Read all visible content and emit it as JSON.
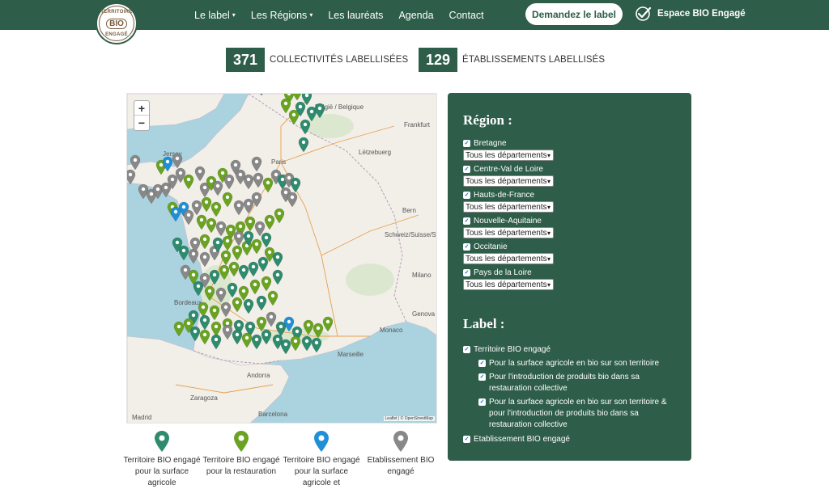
{
  "header": {
    "logo": {
      "top": "TERRITOIRE",
      "middle": "BIO",
      "bottom": "ENGAGÉ"
    },
    "nav": [
      {
        "label": "Le label",
        "has_caret": true
      },
      {
        "label": "Les Régions",
        "has_caret": true
      },
      {
        "label": "Les lauréats",
        "has_caret": false
      },
      {
        "label": "Agenda",
        "has_caret": false
      },
      {
        "label": "Contact",
        "has_caret": false
      }
    ],
    "cta_label": "Demandez le label",
    "espace_label": "Espace BIO Engagé",
    "caret": "▾"
  },
  "stats": [
    {
      "value": "371",
      "label": "COLLECTIVITÉS LABELLISÉES"
    },
    {
      "value": "129",
      "label": "ÉTABLISSEMENTS LABELLISÉS"
    }
  ],
  "map": {
    "zoom_in": "+",
    "zoom_out": "−",
    "attribution": "Leaflet | © OpenStreetMap",
    "labels": {
      "belgique": "België / Belgique",
      "luxembourg": "Lëtzebuerg",
      "frankfurt": "Frankfurt",
      "paris": "Paris",
      "jersey": "Jersey",
      "bern": "Bern",
      "schweiz": "Schweiz/Suisse/Svizzera",
      "milano": "Milano",
      "genova": "Genova",
      "monaco": "Monaco",
      "marseille": "Marseille",
      "bordeaux": "Bordeaux",
      "andorra": "Andorra",
      "zaragoza": "Zaragoza",
      "barcelona": "Barcelona",
      "madrid": "Madrid"
    }
  },
  "legend": [
    {
      "color": "#2e8b6e",
      "text": "Territoire BIO engagé pour la surface agricole"
    },
    {
      "color": "#6aa321",
      "text": "Territoire BIO engagé pour la restauration"
    },
    {
      "color": "#1f8fd6",
      "text": "Territoire BIO engagé pour la surface agricole et"
    },
    {
      "color": "#888888",
      "text": "Etablissement BIO engagé"
    }
  ],
  "filters": {
    "region_title": "Région :",
    "regions": [
      {
        "label": "Bretagne",
        "checked": true,
        "select": "Tous les départements"
      },
      {
        "label": "Centre-Val de Loire",
        "checked": true,
        "select": "Tous les départements"
      },
      {
        "label": "Hauts-de-France",
        "checked": true,
        "select": "Tous les départements"
      },
      {
        "label": "Nouvelle-Aquitaine",
        "checked": true,
        "select": "Tous les départements"
      },
      {
        "label": "Occitanie",
        "checked": true,
        "select": "Tous les départements"
      },
      {
        "label": "Pays de la Loire",
        "checked": true,
        "select": "Tous les départements"
      }
    ],
    "label_title": "Label :",
    "labels": {
      "territoire": "Territoire BIO engagé",
      "surface": "Pour la surface agricole en bio sur son territoire",
      "restauration": "Pour l'introduction de produits bio dans sa restauration collective",
      "both": "Pour la surface agricole en bio sur son territoire & pour l'introduction de produits bio dans sa restauration collective",
      "etablissement": "Etablissement BIO engagé"
    },
    "check_mark": "✓"
  },
  "colors": {
    "brand": "#2e5d49",
    "pin_teal": "#2e8b6e",
    "pin_green": "#6aa321",
    "pin_blue": "#1f8fd6",
    "pin_gray": "#888888"
  }
}
